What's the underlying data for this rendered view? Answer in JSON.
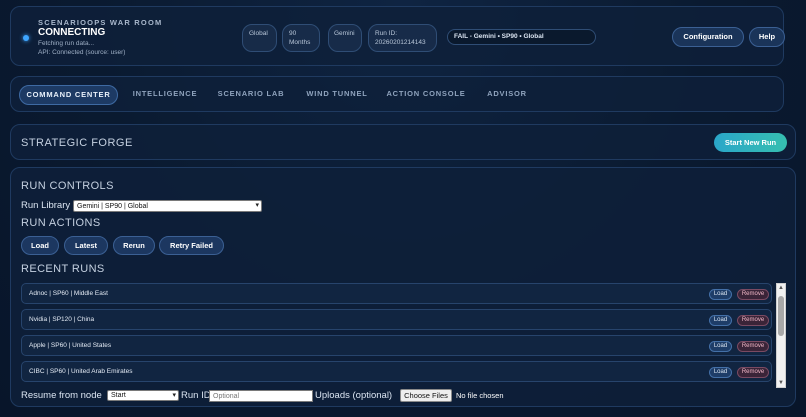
{
  "header": {
    "kicker": "SCENARIOOPS WAR ROOM",
    "status": "CONNECTING",
    "status_detail": "Fetching run data...",
    "api_status": "API: Connected (source: user)",
    "pills": {
      "scope": "Global",
      "horizon_line1": "90",
      "horizon_line2": "Months",
      "model": "Gemini",
      "run_id_label": "Run ID:",
      "run_id_value": "20260201214143"
    },
    "run_summary": "FAIL - Gemini • SP90 • Global",
    "config_label": "Configuration",
    "help_label": "Help",
    "accent_color": "#3ea6ff"
  },
  "nav": {
    "tabs": [
      {
        "label": "COMMAND CENTER",
        "active": true
      },
      {
        "label": "INTELLIGENCE",
        "active": false
      },
      {
        "label": "SCENARIO LAB",
        "active": false
      },
      {
        "label": "WIND TUNNEL",
        "active": false
      },
      {
        "label": "ACTION CONSOLE",
        "active": false
      },
      {
        "label": "ADVISOR",
        "active": false
      }
    ]
  },
  "forge": {
    "title": "STRATEGIC FORGE",
    "start_label": "Start New Run"
  },
  "controls": {
    "run_controls_title": "RUN CONTROLS",
    "library_label": "Run Library",
    "library_value": "Gemini | SP90 | Global",
    "run_actions_title": "RUN ACTIONS",
    "actions": [
      "Load",
      "Latest",
      "Rerun",
      "Retry Failed"
    ],
    "recent_runs_title": "RECENT RUNS",
    "recent_runs": [
      {
        "name": "Adnoc | SP60 | Middle East"
      },
      {
        "name": "Nvidia | SP120 | China"
      },
      {
        "name": "Apple | SP60 | United States"
      },
      {
        "name": "CIBC | SP60 | United Arab Emirates"
      }
    ],
    "row_load_label": "Load",
    "row_remove_label": "Remove",
    "resume_label": "Resume from node",
    "resume_value": "Start",
    "run_id_label": "Run ID",
    "run_id_placeholder": "Optional",
    "uploads_label": "Uploads (optional)",
    "choose_files_label": "Choose Files",
    "no_file_label": "No file chosen"
  }
}
